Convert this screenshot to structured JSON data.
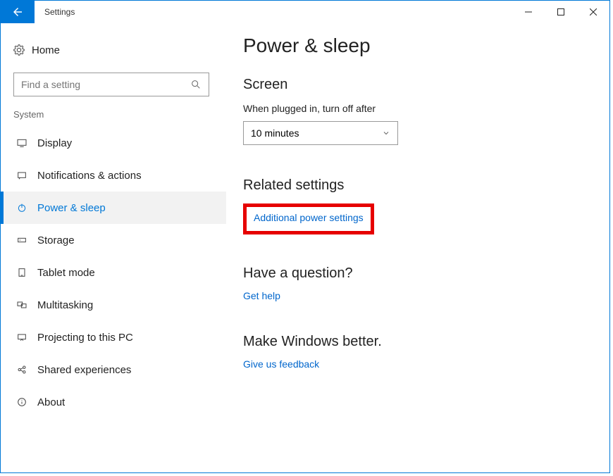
{
  "window": {
    "title": "Settings"
  },
  "sidebar": {
    "home_label": "Home",
    "search_placeholder": "Find a setting",
    "group_label": "System",
    "items": [
      {
        "label": "Display"
      },
      {
        "label": "Notifications & actions"
      },
      {
        "label": "Power & sleep"
      },
      {
        "label": "Storage"
      },
      {
        "label": "Tablet mode"
      },
      {
        "label": "Multitasking"
      },
      {
        "label": "Projecting to this PC"
      },
      {
        "label": "Shared experiences"
      },
      {
        "label": "About"
      }
    ]
  },
  "main": {
    "page_title": "Power & sleep",
    "screen_head": "Screen",
    "screen_label": "When plugged in, turn off after",
    "screen_value": "10 minutes",
    "related_head": "Related settings",
    "related_link": "Additional power settings",
    "question_head": "Have a question?",
    "question_link": "Get help",
    "feedback_head": "Make Windows better.",
    "feedback_link": "Give us feedback"
  }
}
